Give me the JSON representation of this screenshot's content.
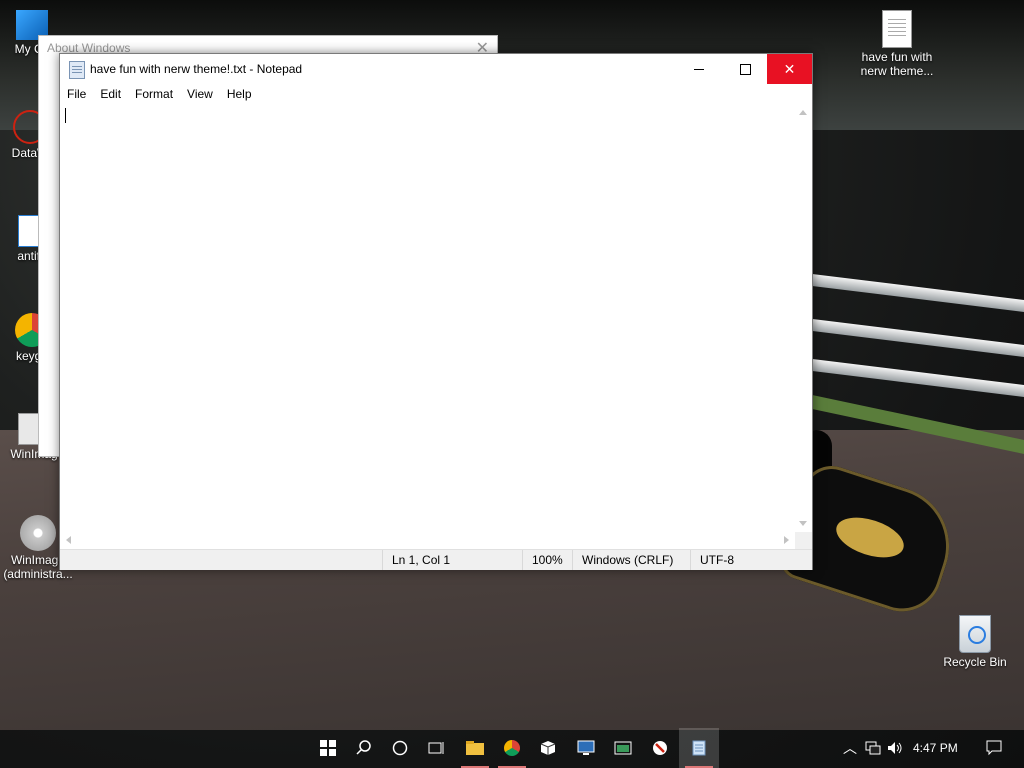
{
  "desktop": {
    "icons": [
      {
        "label": "My Co",
        "icon": "pc-icon"
      },
      {
        "label": "DataW",
        "icon": "datawatch-icon"
      },
      {
        "label": "antifa",
        "icon": "app-icon"
      },
      {
        "label": "keyge",
        "icon": "chrome-icon"
      },
      {
        "label": "WinImag",
        "icon": "winimage-icon"
      },
      {
        "label": "WinImage (administra...",
        "icon": "winimage-admin-icon"
      },
      {
        "label": "have fun with nerw theme...",
        "icon": "text-file-icon"
      },
      {
        "label": "Recycle Bin",
        "icon": "recycle-bin-icon"
      }
    ]
  },
  "about_window": {
    "title": "About Windows",
    "close_glyph": "✕"
  },
  "notepad": {
    "title": "have fun with nerw theme!.txt - Notepad",
    "menu": [
      "File",
      "Edit",
      "Format",
      "View",
      "Help"
    ],
    "status": {
      "position": "Ln 1, Col 1",
      "zoom": "100%",
      "line_ending": "Windows (CRLF)",
      "encoding": "UTF-8"
    }
  },
  "taskbar": {
    "time": "4:47 PM",
    "items": [
      "start-icon",
      "search-icon",
      "cortana-icon",
      "task-view-icon",
      "file-explorer-icon",
      "chrome-icon",
      "package-icon",
      "remote-desktop-icon",
      "window-app-icon",
      "antivirus-icon",
      "notepad-icon"
    ]
  }
}
